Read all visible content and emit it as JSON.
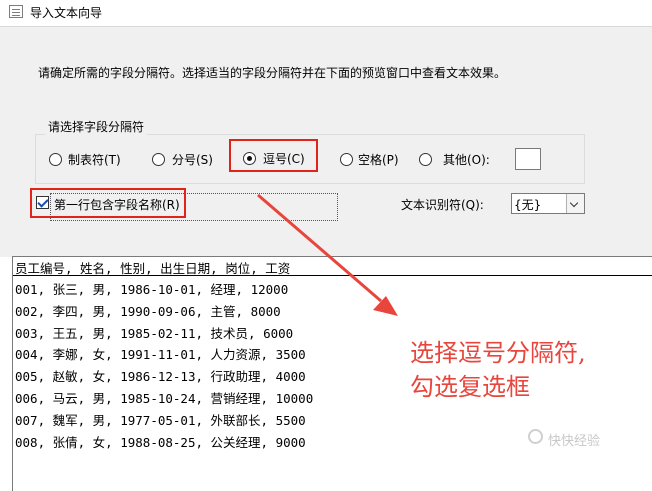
{
  "window": {
    "title": "导入文本向导"
  },
  "instruction": "请确定所需的字段分隔符。选择适当的字段分隔符并在下面的预览窗口中查看文本效果。",
  "delimiter_group": {
    "title": "请选择字段分隔符",
    "options": [
      {
        "label": "制表符(T)",
        "checked": false
      },
      {
        "label": "分号(S)",
        "checked": false
      },
      {
        "label": "逗号(C)",
        "checked": true
      },
      {
        "label": "空格(P)",
        "checked": false
      },
      {
        "label": "其他(O):",
        "checked": false
      }
    ],
    "other_value": ""
  },
  "first_row_checkbox": {
    "label": "第一行包含字段名称(R)",
    "checked": true
  },
  "text_qualifier": {
    "label": "文本识别符(Q):",
    "value": "{无}"
  },
  "preview": {
    "header": "员工编号, 姓名, 性别, 出生日期, 岗位, 工资",
    "rows": [
      "001, 张三, 男, 1986-10-01, 经理, 12000",
      "002, 李四, 男, 1990-09-06, 主管, 8000",
      "003, 王五, 男, 1985-02-11, 技术员, 6000",
      "004, 李娜, 女, 1991-11-01, 人力资源, 3500",
      "005, 赵敏, 女, 1986-12-13, 行政助理, 4000",
      "006, 马云, 男, 1985-10-24, 营销经理, 10000",
      "007, 魏军, 男, 1977-05-01, 外联部长, 5500",
      "008, 张倩, 女, 1988-08-25, 公关经理, 9000"
    ]
  },
  "annotation": {
    "line1": "选择逗号分隔符,",
    "line2": "勾选复选框",
    "color": "#e8453c"
  },
  "watermark": "快快经验",
  "accent_color": "#e2231a"
}
